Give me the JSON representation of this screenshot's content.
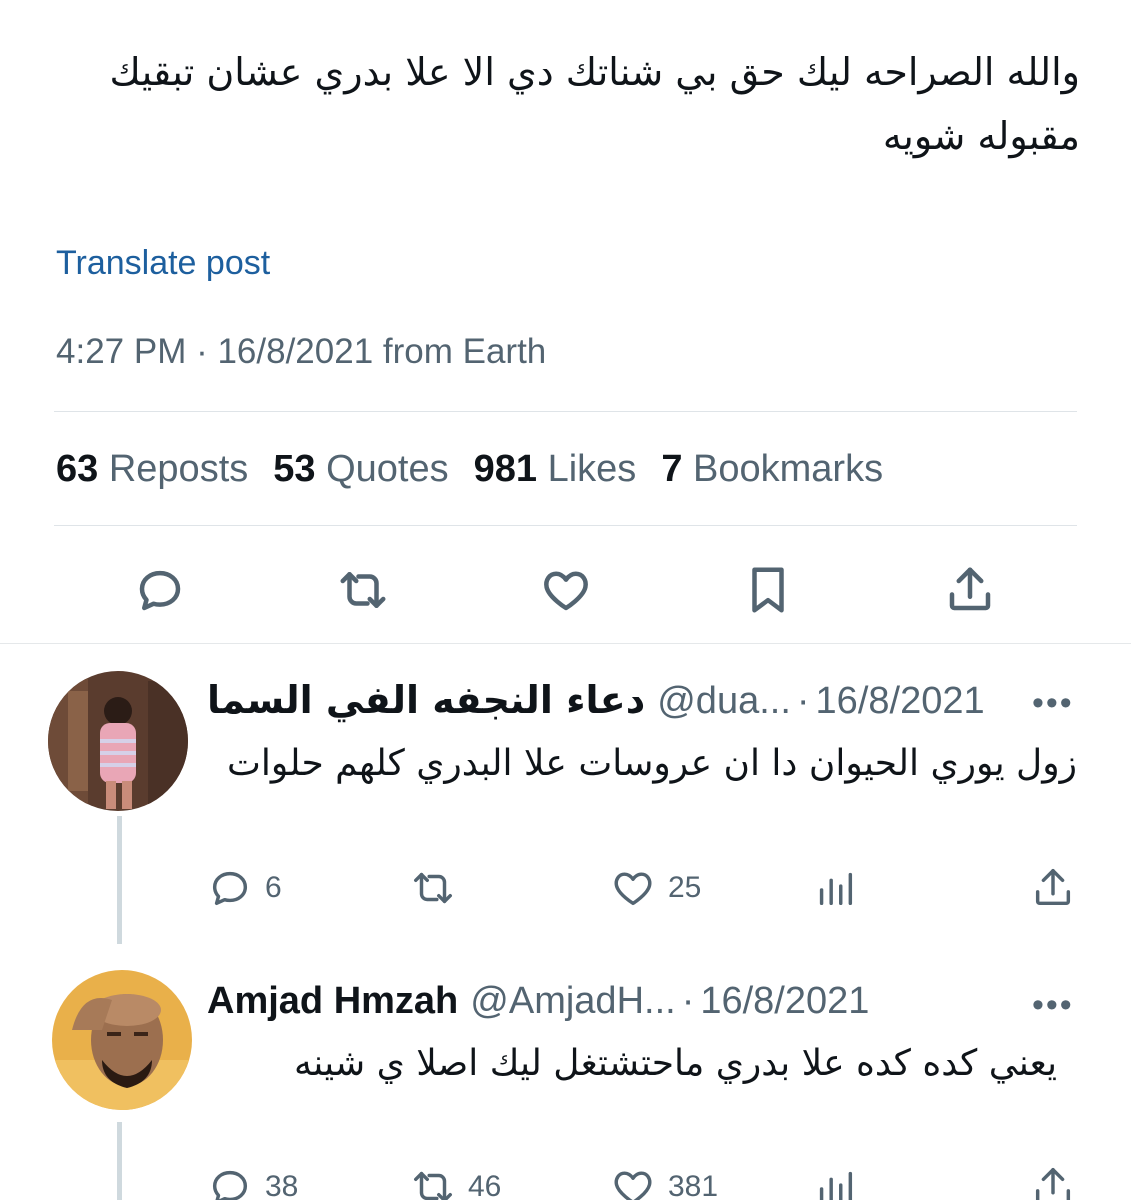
{
  "tweet": {
    "text": "والله الصراحه ليك حق بي شناتك دي الا علا بدري عشان تبقيك مقبوله شويه",
    "translate_label": "Translate post",
    "meta": "4:27 PM · 16/8/2021 from Earth",
    "stats": {
      "reposts_count": "63",
      "reposts_label": "Reposts",
      "quotes_count": "53",
      "quotes_label": "Quotes",
      "likes_count": "981",
      "likes_label": "Likes",
      "bookmarks_count": "7",
      "bookmarks_label": "Bookmarks"
    },
    "action_icons": [
      "reply-icon",
      "repost-icon",
      "like-icon",
      "bookmark-icon",
      "share-icon"
    ]
  },
  "replies": [
    {
      "name": "دعاء النجفه الفي السما",
      "handle": "@dua...",
      "separator": "·",
      "date": "16/8/2021",
      "more": "•••",
      "text": "زول يوري الحيوان دا ان عروسات علا البدري كلهم حلوات",
      "replies": "6",
      "reposts": "",
      "likes": "25"
    },
    {
      "name": "Amjad Hmzah",
      "handle": "@AmjadH...",
      "separator": "·",
      "date": "16/8/2021",
      "more": "•••",
      "text": "يعني كده كده علا بدري ماحتشتغل ليك اصلا ي شينه",
      "replies": "38",
      "reposts": "46",
      "likes": "381"
    }
  ],
  "colors": {
    "link": "#1d5f9e",
    "muted": "#536471",
    "text": "#0f1419",
    "divider": "#dfe4e8",
    "thread_line": "#cfd9de"
  }
}
